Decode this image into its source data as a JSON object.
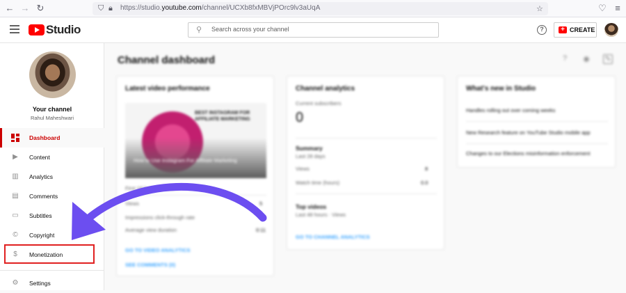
{
  "browser": {
    "url_prefix": "https://studio.",
    "url_domain": "youtube.com",
    "url_path": "/channel/UCXb8fxMBVjPOrc9lv3aUqA"
  },
  "header": {
    "logo_text": "Studio",
    "search_placeholder": "Search across your channel",
    "create_label": "CREATE",
    "help_glyph": "?"
  },
  "sidebar": {
    "your_channel": "Your channel",
    "channel_name": "Rahul Maheshwari",
    "items": [
      {
        "label": "Dashboard",
        "icon": "dashboard-icon",
        "active": true
      },
      {
        "label": "Content",
        "icon": "content-icon"
      },
      {
        "label": "Analytics",
        "icon": "analytics-icon"
      },
      {
        "label": "Comments",
        "icon": "comments-icon"
      },
      {
        "label": "Subtitles",
        "icon": "subtitles-icon"
      },
      {
        "label": "Copyright",
        "icon": "copyright-icon"
      },
      {
        "label": "Monetization",
        "icon": "dollar-icon"
      },
      {
        "label": "Settings",
        "icon": "gear-icon"
      }
    ]
  },
  "main": {
    "title": "Channel dashboard",
    "latest_video": {
      "title": "Latest video performance",
      "thumb_heading": "BEST INSTAGRAM FOR AFFILIATE MARKETING",
      "thumb_caption": "How to Use Instagram For Affiliate Marketing",
      "first_label": "First 18 hours 1 minute",
      "rows": [
        {
          "label": "Views",
          "value": "5"
        },
        {
          "label": "Impressions click-through rate",
          "value": "—"
        },
        {
          "label": "Average view duration",
          "value": "0:11"
        }
      ],
      "link1": "GO TO VIDEO ANALYTICS",
      "link2": "SEE COMMENTS (0)"
    },
    "channel_analytics": {
      "title": "Channel analytics",
      "subs_label": "Current subscribers",
      "subs_value": "0",
      "summary_title": "Summary",
      "summary_sub": "Last 28 days",
      "rows": [
        {
          "label": "Views",
          "value": "8"
        },
        {
          "label": "Watch time (hours)",
          "value": "0.0"
        }
      ],
      "top_videos_title": "Top videos",
      "top_videos_sub": "Last 48 hours · Views",
      "link": "GO TO CHANNEL ANALYTICS"
    },
    "whats_new": {
      "title": "What's new in Studio",
      "items": [
        "Handles rolling out over coming weeks",
        "New Research feature on YouTube Studio mobile app",
        "Changes to our Elections misinformation enforcement"
      ]
    }
  },
  "colors": {
    "accent": "#cc0000",
    "annotation_box": "#e02020",
    "annotation_arrow": "#6c4ef0"
  }
}
